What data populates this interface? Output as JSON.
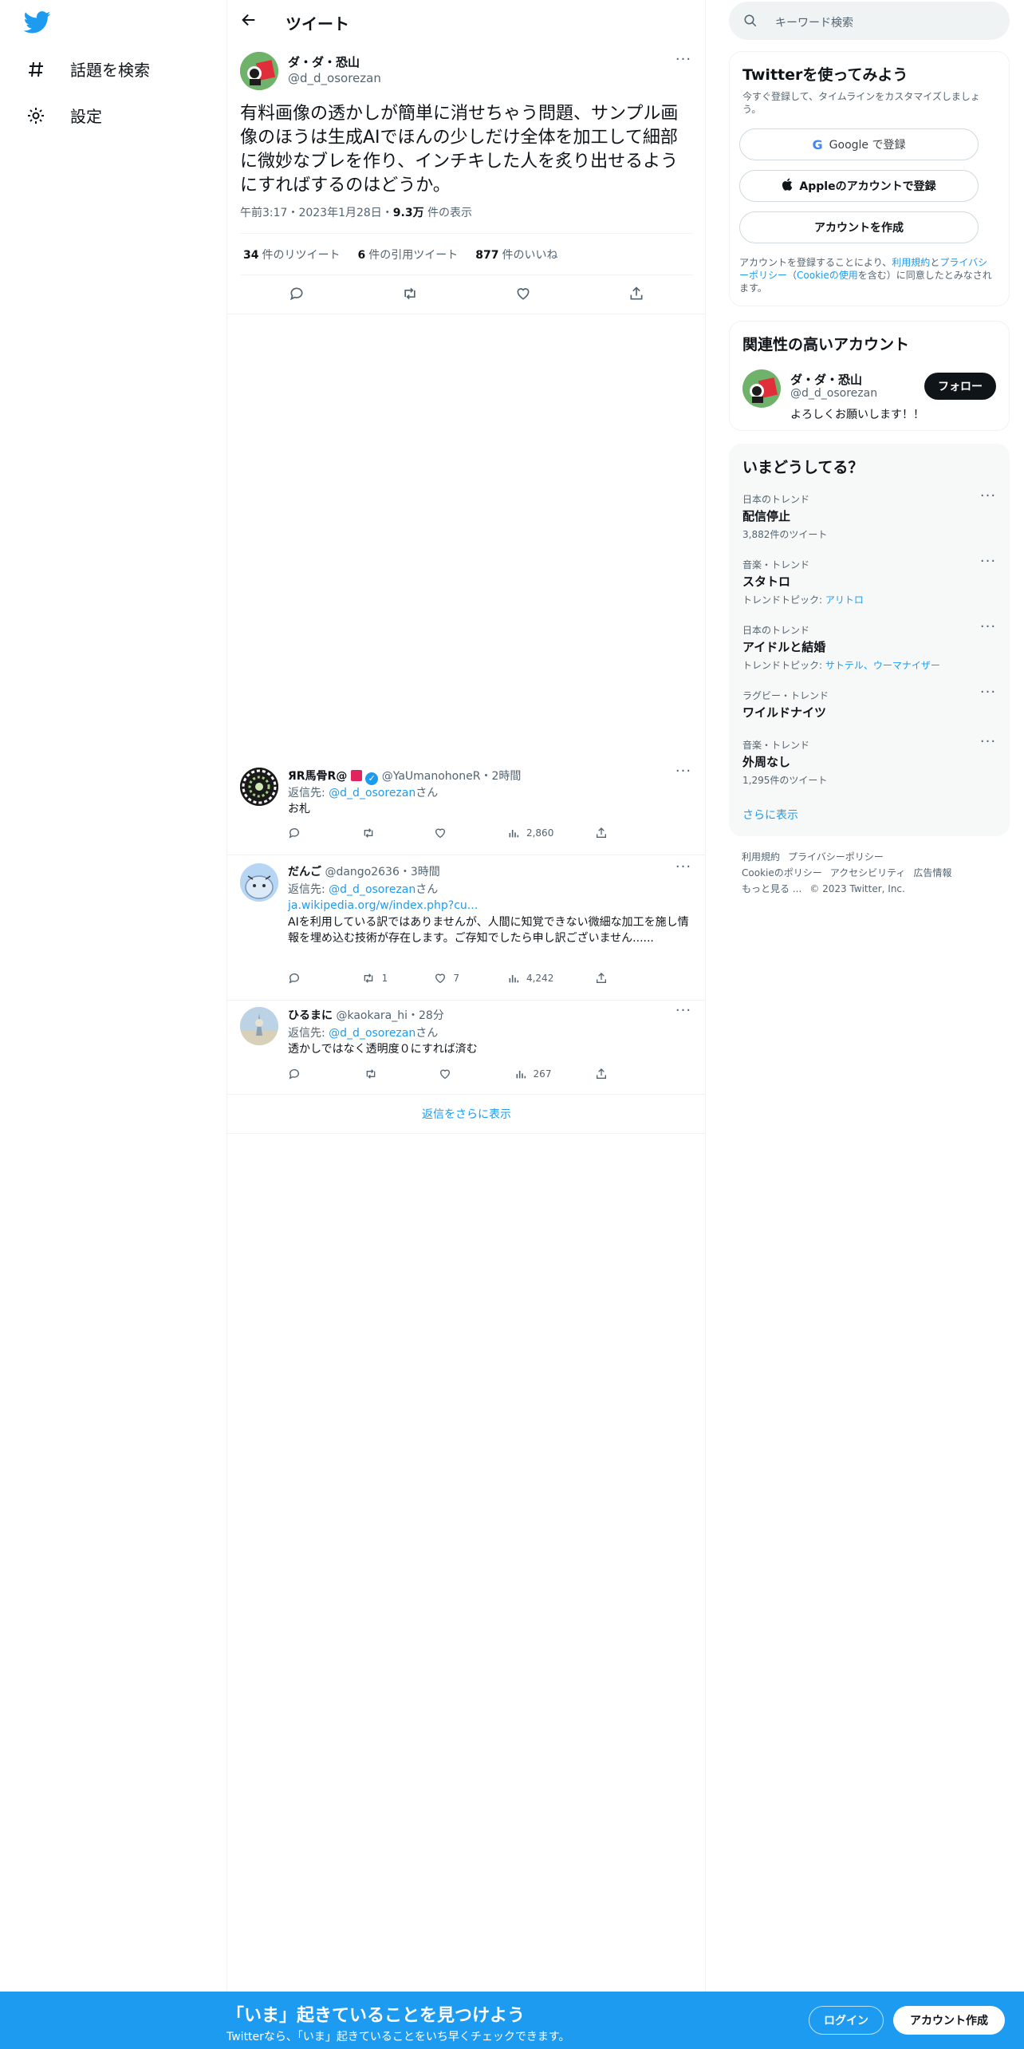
{
  "nav": {
    "items": [
      {
        "label": "話題を検索",
        "icon": "hashtag-icon"
      },
      {
        "label": "設定",
        "icon": "gear-icon"
      }
    ]
  },
  "header": {
    "title": "ツイート"
  },
  "tweet": {
    "name": "ダ・ダ・恐山",
    "handle": "@d_d_osorezan",
    "text": "有料画像の透かしが簡単に消せちゃう問題、サンプル画像のほうは生成AIでほんの少しだけ全体を加工して細部に微妙なブレを作り、インチキした人を炙り出せるようにすればするのはどうか。",
    "time": "午前3:17・2023年1月28日・",
    "views_count": "9.3万",
    "views_label": " 件の表示",
    "retweets_count": "34",
    "retweets_label": "件のリツイート",
    "quotes_count": "6",
    "quotes_label": "件の引用ツイート",
    "likes_count": "877",
    "likes_label": "件のいいね"
  },
  "replies": [
    {
      "name": "ЯR馬骨R@",
      "handle": "@YaUmanohoneR",
      "time": "・2時間",
      "to_prefix": "返信先: ",
      "to_handle": "@d_d_osorezan",
      "to_suffix": "さん",
      "link": "",
      "text": "お札",
      "retweets": "",
      "likes": "",
      "views": "2,860"
    },
    {
      "name": "だんご",
      "handle": "@dango2636",
      "time": "・3時間",
      "to_prefix": "返信先: ",
      "to_handle": "@d_d_osorezan",
      "to_suffix": "さん",
      "link": "ja.wikipedia.org/w/index.php?cu...",
      "text": "AIを利用している訳ではありませんが、人間に知覚できない微細な加工を施し情報を埋め込む技術が存在します。ご存知でしたら申し訳ございません......",
      "retweets": "1",
      "likes": "7",
      "views": "4,242"
    },
    {
      "name": "ひるまに",
      "handle": "@kaokara_hi",
      "time": "・28分",
      "to_prefix": "返信先: ",
      "to_handle": "@d_d_osorezan",
      "to_suffix": "さん",
      "link": "",
      "text": "透かしではなく透明度０にすれば済む",
      "retweets": "",
      "likes": "",
      "views": "267"
    }
  ],
  "show_more_replies": "返信をさらに表示",
  "search": {
    "placeholder": "キーワード検索"
  },
  "signup_card": {
    "title": "Twitterを使ってみよう",
    "subtitle": "今すぐ登録して、タイムラインをカスタマイズしましょう。",
    "google_label": "Google で登録",
    "apple_label": "Appleのアカウントで登録",
    "create_label": "アカウントを作成",
    "legal_prefix": "アカウントを登録することにより、",
    "legal_terms": "利用規約",
    "legal_and": "と",
    "legal_privacy": "プライバシーポリシー",
    "legal_paren_open": "（",
    "legal_cookie": "Cookieの使用",
    "legal_suffix": "を含む）に同意したとみなされます。"
  },
  "related": {
    "title": "関連性の高いアカウント",
    "name": "ダ・ダ・恐山",
    "handle": "@d_d_osorezan",
    "bio": "よろしくお願いします！！",
    "follow_label": "フォロー"
  },
  "trends": {
    "title": "いまどうしてる？",
    "items": [
      {
        "category": "日本のトレンド",
        "title": "配信停止",
        "extra": "3,882件のツイート",
        "topic_prefix": "",
        "topics": ""
      },
      {
        "category": "音楽・トレンド",
        "title": "スタトロ",
        "extra": "",
        "topic_prefix": "トレンドトピック: ",
        "topics": "アリトロ"
      },
      {
        "category": "日本のトレンド",
        "title": "アイドルと結婚",
        "extra": "",
        "topic_prefix": "トレンドトピック: ",
        "topics": "サトテル、ウーマナイザー"
      },
      {
        "category": "ラグビー・トレンド",
        "title": "ワイルドナイツ",
        "extra": "",
        "topic_prefix": "",
        "topics": ""
      },
      {
        "category": "音楽・トレンド",
        "title": "外周なし",
        "extra": "1,295件のツイート",
        "topic_prefix": "",
        "topics": ""
      }
    ],
    "show_more": "さらに表示"
  },
  "footer": {
    "links": [
      "利用規約",
      "プライバシーポリシー",
      "Cookieのポリシー",
      "アクセシビリティ",
      "広告情報",
      "もっと見る ..."
    ],
    "copyright": "© 2023 Twitter, Inc."
  },
  "banner": {
    "headline": "「いま」起きていることを見つけよう",
    "sub": "Twitterなら、「いま」起きていることをいち早くチェックできます。",
    "login": "ログイン",
    "signup": "アカウント作成"
  },
  "colors": {
    "accent": "#1d9bf0",
    "text": "#0f1419",
    "muted": "#536471"
  }
}
